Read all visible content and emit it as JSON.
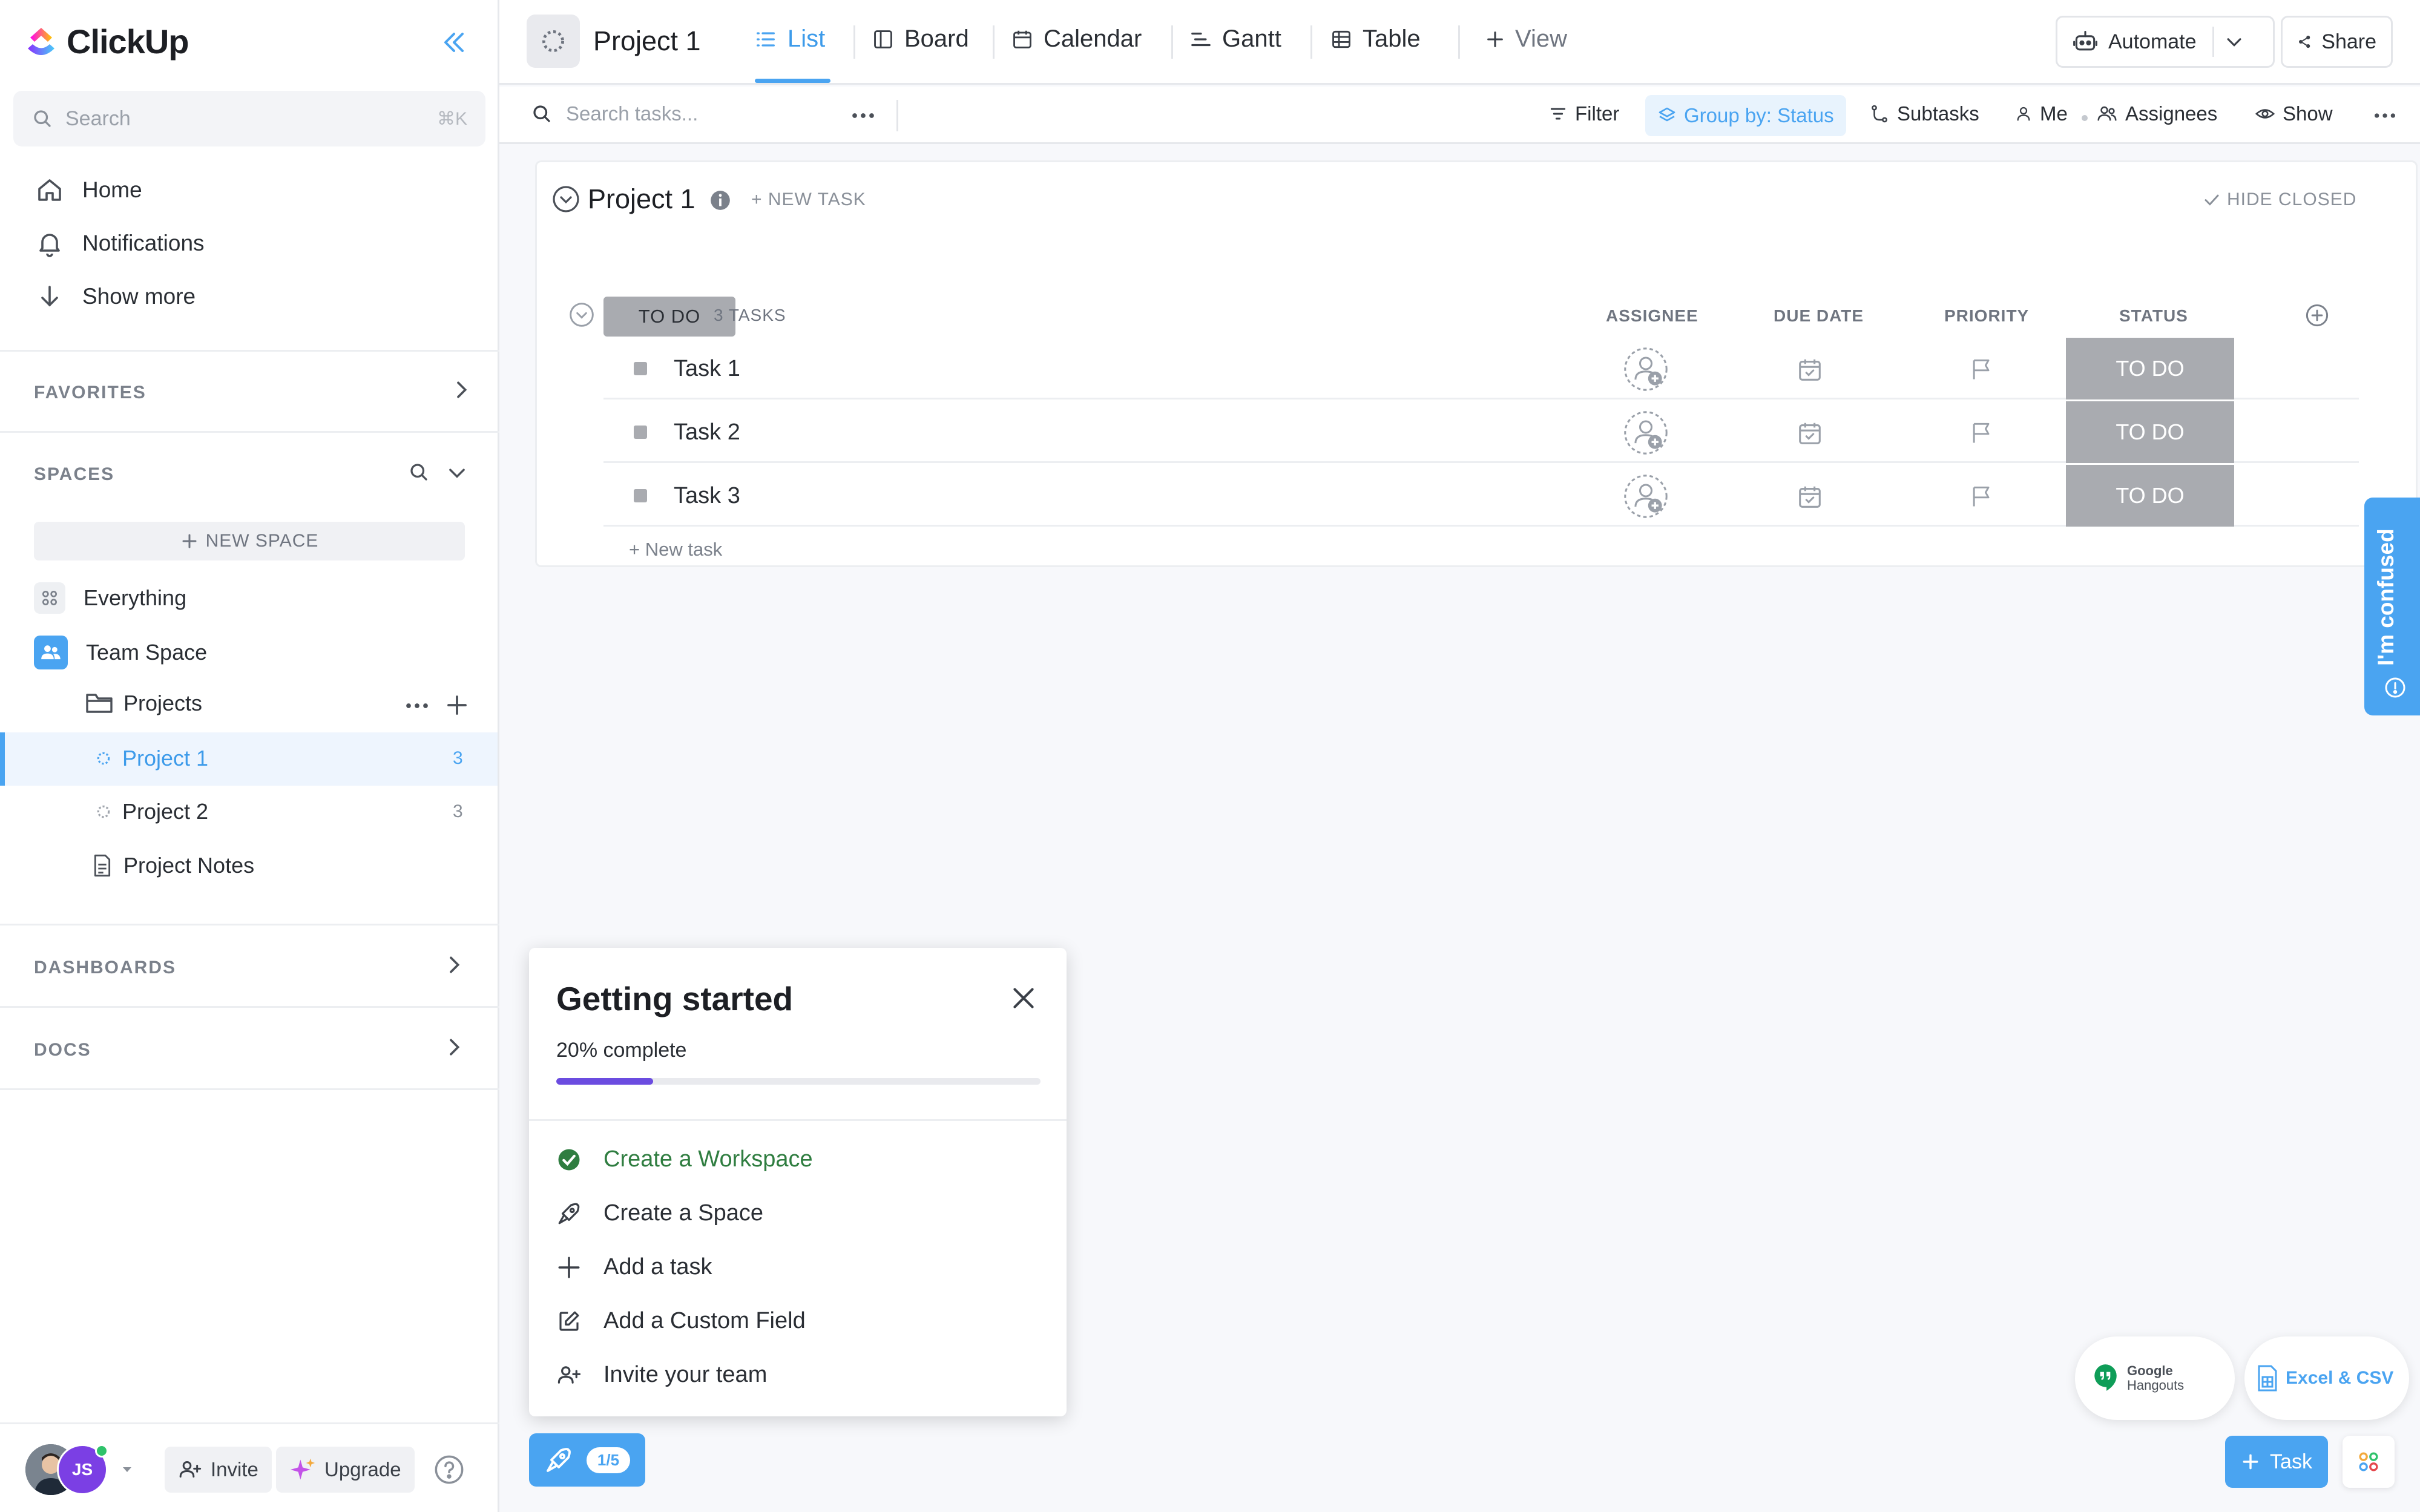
{
  "app": {
    "name": "ClickUp"
  },
  "colors": {
    "accent": "#4aa4f1",
    "status_todo": "#a9abb0",
    "progress": "#6b4ce0",
    "done_green": "#2f7d40"
  },
  "sidebar": {
    "search": {
      "placeholder": "Search",
      "shortcut": "⌘K"
    },
    "nav": [
      {
        "label": "Home",
        "icon": "home-icon"
      },
      {
        "label": "Notifications",
        "icon": "bell-icon"
      },
      {
        "label": "Show more",
        "icon": "arrow-down-icon"
      }
    ],
    "favorites_title": "FAVORITES",
    "spaces_title": "SPACES",
    "new_space_label": "NEW SPACE",
    "tree": {
      "everything": "Everything",
      "team_space": "Team Space",
      "projects_folder": "Projects",
      "lists": [
        {
          "label": "Project 1",
          "count": "3"
        },
        {
          "label": "Project 2",
          "count": "3"
        }
      ],
      "doc": "Project Notes"
    },
    "dashboards_title": "DASHBOARDS",
    "docs_title": "DOCS",
    "footer": {
      "avatar_initials": "JS",
      "invite": "Invite",
      "upgrade": "Upgrade"
    }
  },
  "topbar": {
    "project_title": "Project 1",
    "tabs": [
      {
        "label": "List",
        "icon": "list-icon",
        "active": true
      },
      {
        "label": "Board",
        "icon": "board-icon"
      },
      {
        "label": "Calendar",
        "icon": "calendar-icon"
      },
      {
        "label": "Gantt",
        "icon": "gantt-icon"
      },
      {
        "label": "Table",
        "icon": "table-icon"
      }
    ],
    "add_view": "View",
    "automate": "Automate",
    "share": "Share"
  },
  "toolbar": {
    "search_placeholder": "Search tasks...",
    "filter": "Filter",
    "group_by": "Group by: Status",
    "subtasks": "Subtasks",
    "me": "Me",
    "assignees": "Assignees",
    "show": "Show"
  },
  "list": {
    "title": "Project 1",
    "new_task": "+ NEW TASK",
    "hide_closed": "HIDE CLOSED",
    "group": {
      "status": "TO DO",
      "count": "3 TASKS"
    },
    "columns": [
      "ASSIGNEE",
      "DUE DATE",
      "PRIORITY",
      "STATUS"
    ],
    "tasks": [
      {
        "name": "Task 1",
        "status": "TO DO"
      },
      {
        "name": "Task 2",
        "status": "TO DO"
      },
      {
        "name": "Task 3",
        "status": "TO DO"
      }
    ],
    "new_task_link": "+ New task"
  },
  "getting_started": {
    "title": "Getting started",
    "progress_label": "20% complete",
    "progress": 0.2,
    "items": [
      {
        "label": "Create a Workspace",
        "icon": "check-circle-icon",
        "done": true
      },
      {
        "label": "Create a Space",
        "icon": "rocket-outline-icon"
      },
      {
        "label": "Add a task",
        "icon": "plus-icon"
      },
      {
        "label": "Add a Custom Field",
        "icon": "edit-square-icon"
      },
      {
        "label": "Invite your team",
        "icon": "user-add-icon"
      }
    ],
    "launcher_badge": "1/5"
  },
  "widgets": {
    "confused": "I'm confused",
    "hangouts": [
      "Google",
      "Hangouts"
    ],
    "excel_csv": "Excel & CSV",
    "task_fab": "Task"
  }
}
